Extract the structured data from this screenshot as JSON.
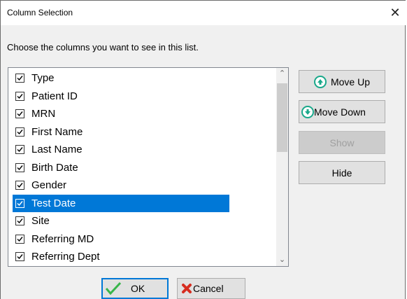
{
  "window": {
    "title": "Column Selection",
    "close_glyph": "✕"
  },
  "instruction": "Choose the columns you want to see in this list.",
  "columns": [
    {
      "label": "Type",
      "checked": true,
      "selected": false
    },
    {
      "label": "Patient  ID",
      "checked": true,
      "selected": false
    },
    {
      "label": "MRN",
      "checked": true,
      "selected": false
    },
    {
      "label": "First Name",
      "checked": true,
      "selected": false
    },
    {
      "label": "Last Name",
      "checked": true,
      "selected": false
    },
    {
      "label": "Birth Date",
      "checked": true,
      "selected": false
    },
    {
      "label": "Gender",
      "checked": true,
      "selected": false
    },
    {
      "label": "Test Date",
      "checked": true,
      "selected": true
    },
    {
      "label": "Site",
      "checked": true,
      "selected": false
    },
    {
      "label": "Referring MD",
      "checked": true,
      "selected": false
    },
    {
      "label": "Referring Dept",
      "checked": true,
      "selected": false
    }
  ],
  "scrollbar": {
    "up_glyph": "⌃",
    "down_glyph": "⌄"
  },
  "buttons": {
    "move_up": "Move Up",
    "move_down": "Move Down",
    "show": "Show",
    "hide": "Hide",
    "ok": "OK",
    "cancel": "Cancel"
  },
  "colors": {
    "selection": "#0078d7",
    "move_icon": "#1aa88a",
    "ok_check": "#39b54a",
    "cancel_x": "#d62d20"
  }
}
